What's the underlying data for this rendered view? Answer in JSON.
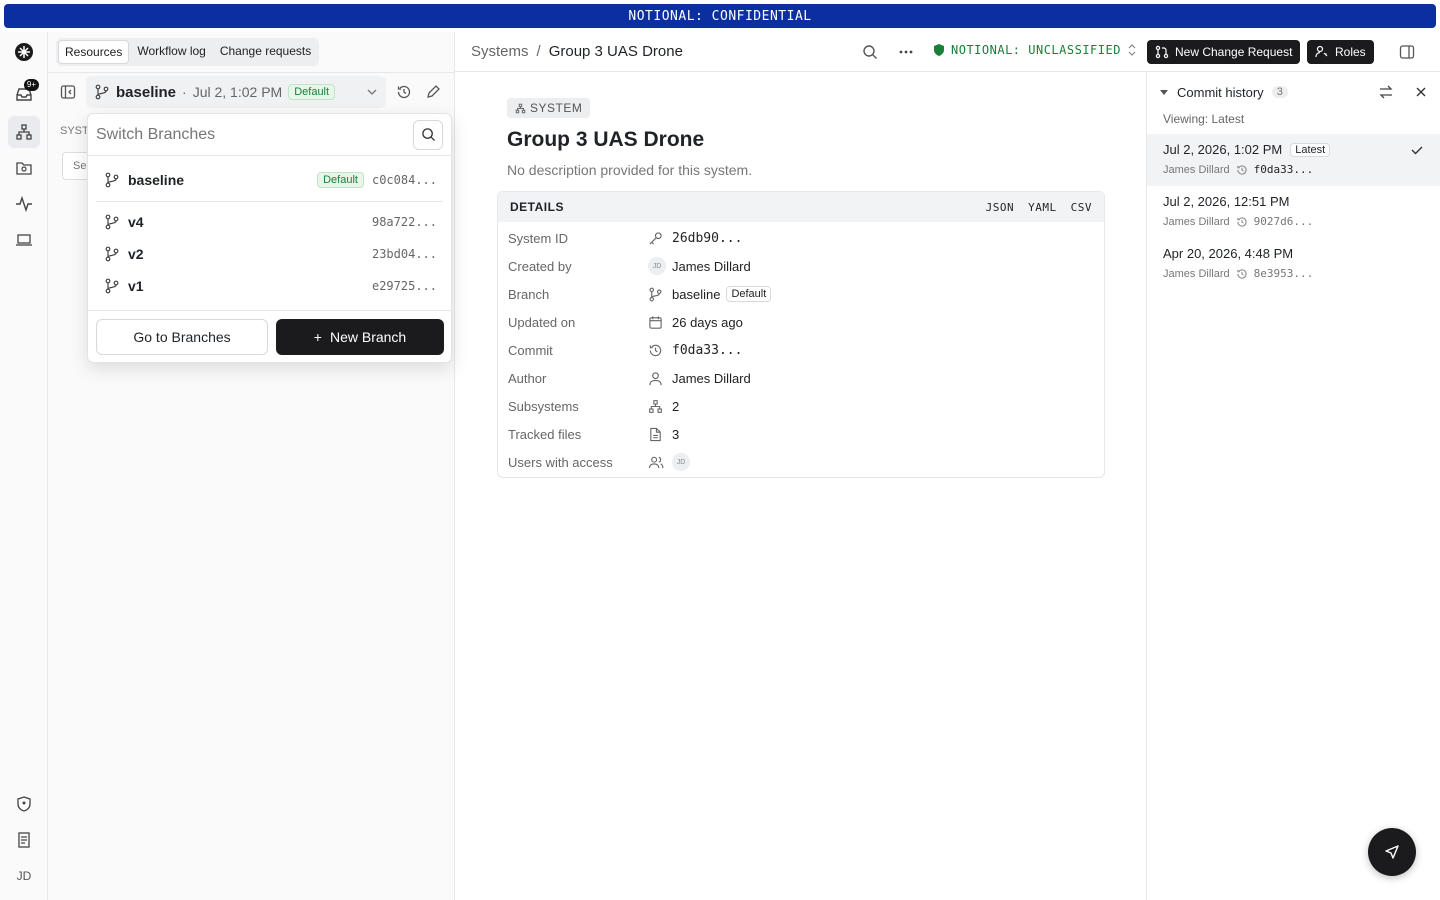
{
  "banner": {
    "text": "NOTIONAL: CONFIDENTIAL"
  },
  "rail": {
    "badge": "9+",
    "user_initials": "JD"
  },
  "panel": {
    "tabs": [
      "Resources",
      "Workflow log",
      "Change requests"
    ],
    "active_tab": "Resources",
    "branch_select": {
      "name": "baseline",
      "separator": "·",
      "date": "Jul 2, 1:02 PM",
      "badge": "Default"
    },
    "behind_section_label": "SYST",
    "behind_search": "Se"
  },
  "branch_dropdown": {
    "placeholder": "Switch Branches",
    "branches": [
      {
        "name": "baseline",
        "badge": "Default",
        "hash": "c0c084..."
      },
      {
        "name": "v4",
        "hash": "98a722..."
      },
      {
        "name": "v2",
        "hash": "23bd04..."
      },
      {
        "name": "v1",
        "hash": "e29725..."
      }
    ],
    "go_label": "Go to Branches",
    "new_label": "New Branch",
    "new_prefix": "+"
  },
  "topbar": {
    "breadcrumb_root": "Systems",
    "breadcrumb_sep": "/",
    "breadcrumb_current": "Group 3 UAS Drone",
    "classification": "NOTIONAL: UNCLASSIFIED",
    "classification_color": "#1a7f37",
    "new_change_request_label": "New Change Request",
    "roles_label": "Roles"
  },
  "system": {
    "chip": "SYSTEM",
    "title": "Group 3 UAS Drone",
    "description": "No description provided for this system.",
    "details_title": "DETAILS",
    "formats": [
      "JSON",
      "YAML",
      "CSV"
    ],
    "rows": [
      {
        "key": "System ID",
        "value": "26db90...",
        "icon": "key-icon"
      },
      {
        "key": "Created by",
        "value": "James Dillard",
        "avatar": "JD"
      },
      {
        "key": "Branch",
        "value": "baseline",
        "badge": "Default",
        "icon": "branch-icon"
      },
      {
        "key": "Updated on",
        "value": "26 days ago",
        "icon": "calendar-icon"
      },
      {
        "key": "Commit",
        "value": "f0da33...",
        "icon": "history-icon"
      },
      {
        "key": "Author",
        "value": "James Dillard",
        "icon": "user-icon"
      },
      {
        "key": "Subsystems",
        "value": "2",
        "icon": "hierarchy-icon"
      },
      {
        "key": "Tracked files",
        "value": "3",
        "icon": "file-icon"
      },
      {
        "key": "Users with access",
        "value": "",
        "avatar": "JD",
        "icon": "users-icon"
      }
    ]
  },
  "history": {
    "title": "Commit history",
    "count": "3",
    "viewing": "Viewing: Latest",
    "items": [
      {
        "date": "Jul 2, 2026, 1:02 PM",
        "badge": "Latest",
        "author": "James Dillard",
        "hash": "f0da33..."
      },
      {
        "date": "Jul 2, 2026, 12:51 PM",
        "author": "James Dillard",
        "hash": "9027d6..."
      },
      {
        "date": "Apr 20, 2026, 4:48 PM",
        "author": "James Dillard",
        "hash": "8e3953..."
      }
    ]
  }
}
